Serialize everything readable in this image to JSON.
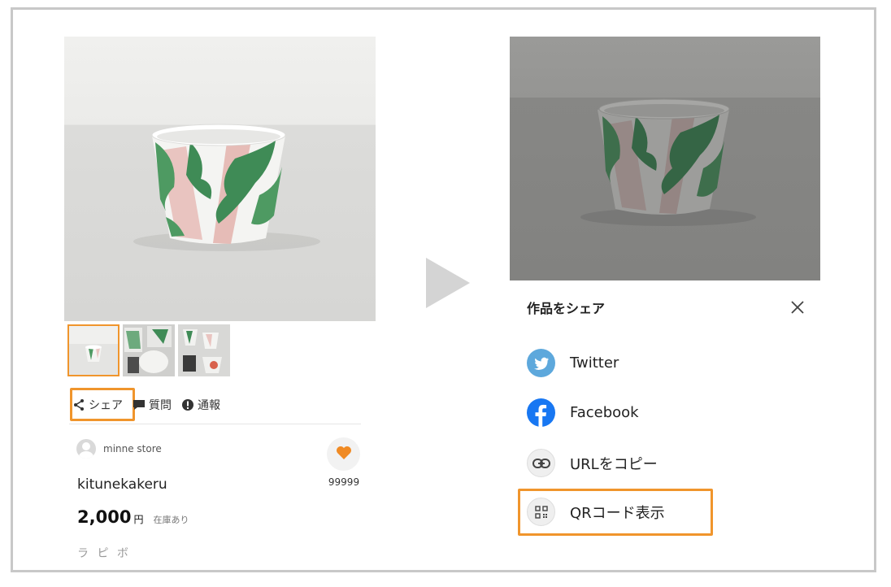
{
  "left_panel": {
    "actions": {
      "share_label": "シェア",
      "question_label": "質問",
      "report_label": "通報"
    },
    "seller_name": "minne store",
    "favorite_count": "99999",
    "product_name": "kitunekakeru",
    "price": "2,000",
    "currency": "円",
    "stock_status": "在庫あり",
    "cut_text": "ラ ピ ボ"
  },
  "share_sheet": {
    "title": "作品をシェア",
    "items": [
      {
        "label": "Twitter",
        "icon": "twitter-icon"
      },
      {
        "label": "Facebook",
        "icon": "facebook-icon"
      },
      {
        "label": "URLをコピー",
        "icon": "link-icon"
      },
      {
        "label": "QRコード表示",
        "icon": "qr-code-icon"
      }
    ]
  },
  "colors": {
    "accent_orange": "#f0952c",
    "twitter_blue": "#5da8dc",
    "facebook_blue": "#1877f2",
    "heart_orange": "#f08a24"
  }
}
